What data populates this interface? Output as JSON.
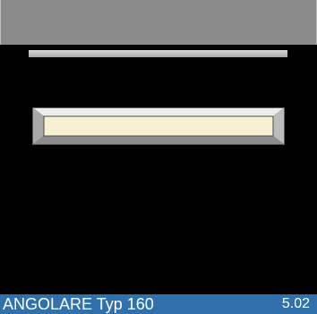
{
  "footer": {
    "title": "ANGOLARE Typ 160",
    "page": "5.02"
  },
  "colors": {
    "background": "#000000",
    "header": "#8a8a8a",
    "footer": "#2f70ad",
    "profile_face": "#f7f0d2",
    "profile_bevel": "#c8c8c8"
  }
}
